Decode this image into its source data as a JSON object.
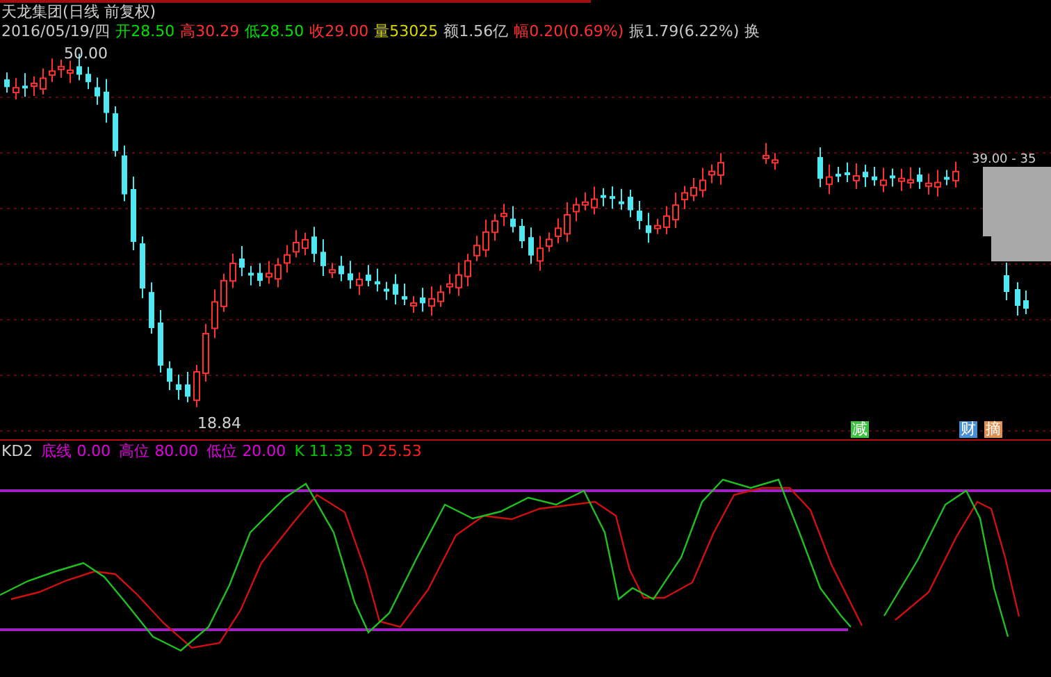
{
  "stock": {
    "title": "天龙集团(日线 前复权)",
    "date": "2016/05/19/四",
    "quote": [
      {
        "label": "开",
        "value": "28.50",
        "color": "#00e000"
      },
      {
        "label": "高",
        "value": "30.29",
        "color": "#ff3030"
      },
      {
        "label": "低",
        "value": "28.50",
        "color": "#00e000"
      },
      {
        "label": "收",
        "value": "29.00",
        "color": "#ff3030"
      },
      {
        "label": "量",
        "value": "53025",
        "color": "#d8d800"
      },
      {
        "label": "额",
        "value": "1.56亿",
        "color": "#c8c8c8"
      },
      {
        "label": "幅",
        "value": "0.20(0.69%)",
        "color": "#ff3030"
      },
      {
        "label": "振",
        "value": "1.79(6.22%)",
        "color": "#c8c8c8"
      },
      {
        "label": "换",
        "color": "#c8c8c8"
      }
    ]
  },
  "price_chart": {
    "high_label": "50.00",
    "low_label": "18.84",
    "range_label": "39.00 - 35",
    "markers": [
      {
        "text": "减",
        "color": "#40c040"
      },
      {
        "text": "财",
        "color": "#4a90d0"
      },
      {
        "text": "摘",
        "color": "#e09050"
      }
    ]
  },
  "indicator": {
    "name": "KD2",
    "params": [
      {
        "label": "底线",
        "value": "0.00",
        "color": "#e000e0"
      },
      {
        "label": "高位",
        "value": "80.00",
        "color": "#e000e0"
      },
      {
        "label": "低位",
        "value": "20.00",
        "color": "#e000e0"
      },
      {
        "label": "K",
        "value": "11.33",
        "color": "#00c800"
      },
      {
        "label": "D",
        "value": "25.53",
        "color": "#ff2020"
      }
    ]
  }
}
